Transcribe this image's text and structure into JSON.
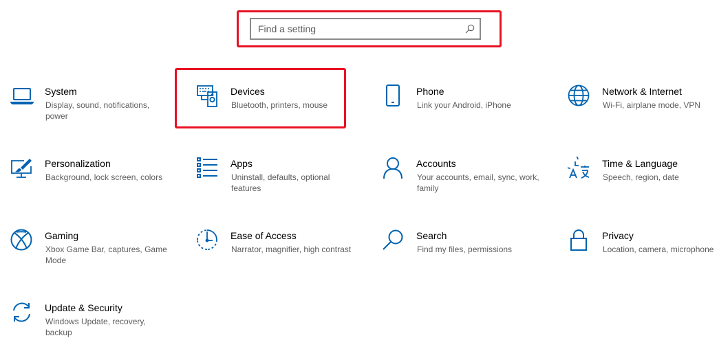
{
  "search": {
    "placeholder": "Find a setting",
    "value": ""
  },
  "accent_color": "#0063b1",
  "highlight_color": "#e81123",
  "tiles": [
    {
      "title": "System",
      "desc": "Display, sound, notifications, power",
      "icon": "laptop-icon"
    },
    {
      "title": "Devices",
      "desc": "Bluetooth, printers, mouse",
      "icon": "keyboard-speaker-icon"
    },
    {
      "title": "Phone",
      "desc": "Link your Android, iPhone",
      "icon": "phone-icon"
    },
    {
      "title": "Network & Internet",
      "desc": "Wi-Fi, airplane mode, VPN",
      "icon": "globe-icon"
    },
    {
      "title": "Personalization",
      "desc": "Background, lock screen, colors",
      "icon": "paint-monitor-icon"
    },
    {
      "title": "Apps",
      "desc": "Uninstall, defaults, optional features",
      "icon": "app-list-icon"
    },
    {
      "title": "Accounts",
      "desc": "Your accounts, email, sync, work, family",
      "icon": "person-icon"
    },
    {
      "title": "Time & Language",
      "desc": "Speech, region, date",
      "icon": "time-language-icon"
    },
    {
      "title": "Gaming",
      "desc": "Xbox Game Bar, captures, Game Mode",
      "icon": "xbox-icon"
    },
    {
      "title": "Ease of Access",
      "desc": "Narrator, magnifier, high contrast",
      "icon": "ease-of-access-icon"
    },
    {
      "title": "Search",
      "desc": "Find my files, permissions",
      "icon": "magnifier-icon"
    },
    {
      "title": "Privacy",
      "desc": "Location, camera, microphone",
      "icon": "lock-icon"
    },
    {
      "title": "Update & Security",
      "desc": "Windows Update, recovery, backup",
      "icon": "sync-icon"
    }
  ]
}
